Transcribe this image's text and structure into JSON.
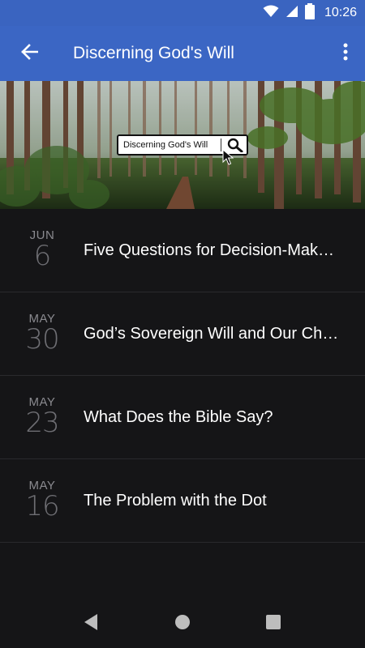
{
  "status_bar": {
    "time": "10:26",
    "icons": [
      "wifi-icon",
      "signal-icon",
      "battery-icon"
    ]
  },
  "app_bar": {
    "title": "Discerning God's Will",
    "back_icon": "arrow-left-icon",
    "menu_icon": "more-vert-icon",
    "background": "#3b66c4"
  },
  "hero": {
    "search_text": "Discerning God's Will",
    "icons": [
      "search-icon",
      "cursor-icon"
    ]
  },
  "episodes": [
    {
      "month": "JUN",
      "day": "6",
      "title": "Five Questions for Decision-Mak…"
    },
    {
      "month": "MAY",
      "day": "30",
      "title": "God’s Sovereign Will and Our Ch…"
    },
    {
      "month": "MAY",
      "day": "23",
      "title": "What Does the Bible Say?"
    },
    {
      "month": "MAY",
      "day": "16",
      "title": "The Problem with the Dot"
    }
  ],
  "nav_bar": {
    "icons": [
      "back-triangle-icon",
      "home-circle-icon",
      "recents-square-icon"
    ]
  },
  "colors": {
    "background": "#151517",
    "divider": "#2a2a2d",
    "date_text": "#6e6e73",
    "title_text": "#ffffff"
  }
}
